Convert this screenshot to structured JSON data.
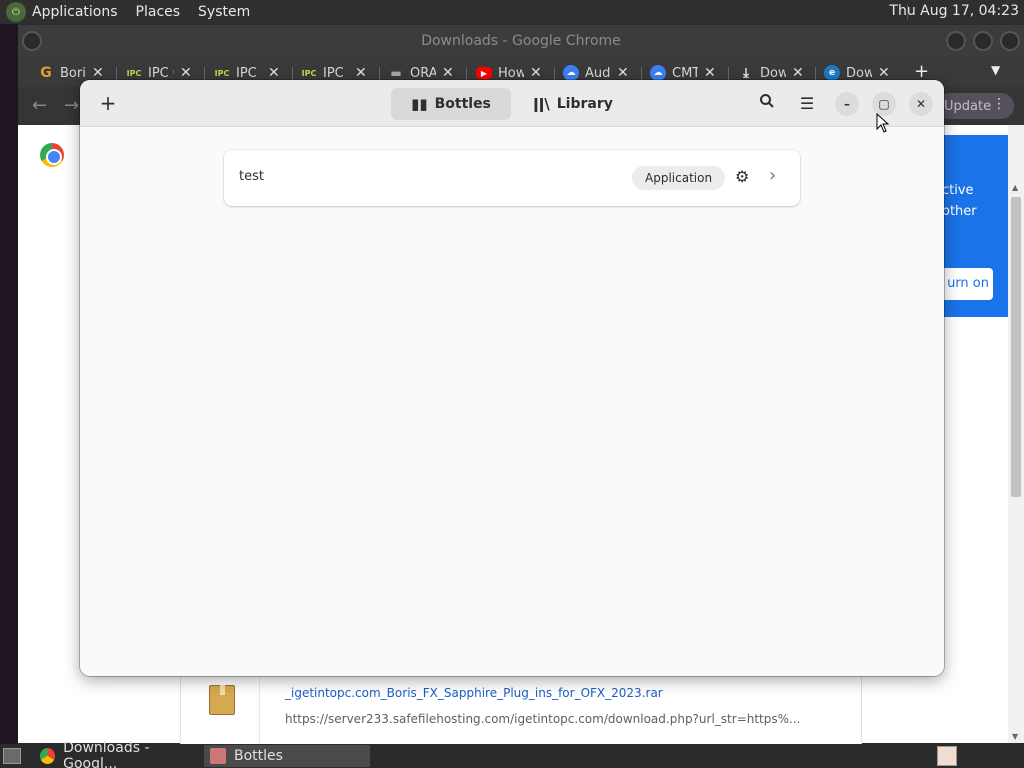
{
  "top_panel": {
    "menus": [
      "Applications",
      "Places",
      "System"
    ],
    "clock": "Thu Aug 17, 04:23"
  },
  "chrome": {
    "title": "Downloads - Google Chrome",
    "tabs": [
      {
        "label": "Bori",
        "icon": "G"
      },
      {
        "label": "IPC G",
        "icon": "IPC"
      },
      {
        "label": "IPC",
        "icon": "IPC"
      },
      {
        "label": "IPC",
        "icon": "IPC"
      },
      {
        "label": "ORA",
        "icon": "drive"
      },
      {
        "label": "How",
        "icon": "youtube"
      },
      {
        "label": "Aud",
        "icon": "cloud"
      },
      {
        "label": "CMT",
        "icon": "cloud"
      },
      {
        "label": "Dow",
        "icon": "download"
      },
      {
        "label": "Dow",
        "icon": "edge"
      }
    ],
    "update_label": "Update",
    "promo": {
      "line1": "ctive",
      "line2": "other",
      "button": "urn on"
    },
    "download": {
      "filename": "_igetintopc.com_Boris_FX_Sapphire_Plug_ins_for_OFX_2023.rar",
      "url": "https://server233.safefilehosting.com/igetintopc.com/download.php?url_str=https%..."
    }
  },
  "bottles": {
    "tabs": [
      {
        "label": "Bottles",
        "active": true
      },
      {
        "label": "Library",
        "active": false
      }
    ],
    "bottle_list": [
      {
        "name": "test",
        "environment": "Application"
      }
    ]
  },
  "taskbar": {
    "tasks": [
      {
        "label": "Downloads - Googl...",
        "active": false
      },
      {
        "label": "Bottles",
        "active": true
      }
    ]
  },
  "colors": {
    "accent": "#1a73e8",
    "link": "#1a5fc8"
  }
}
